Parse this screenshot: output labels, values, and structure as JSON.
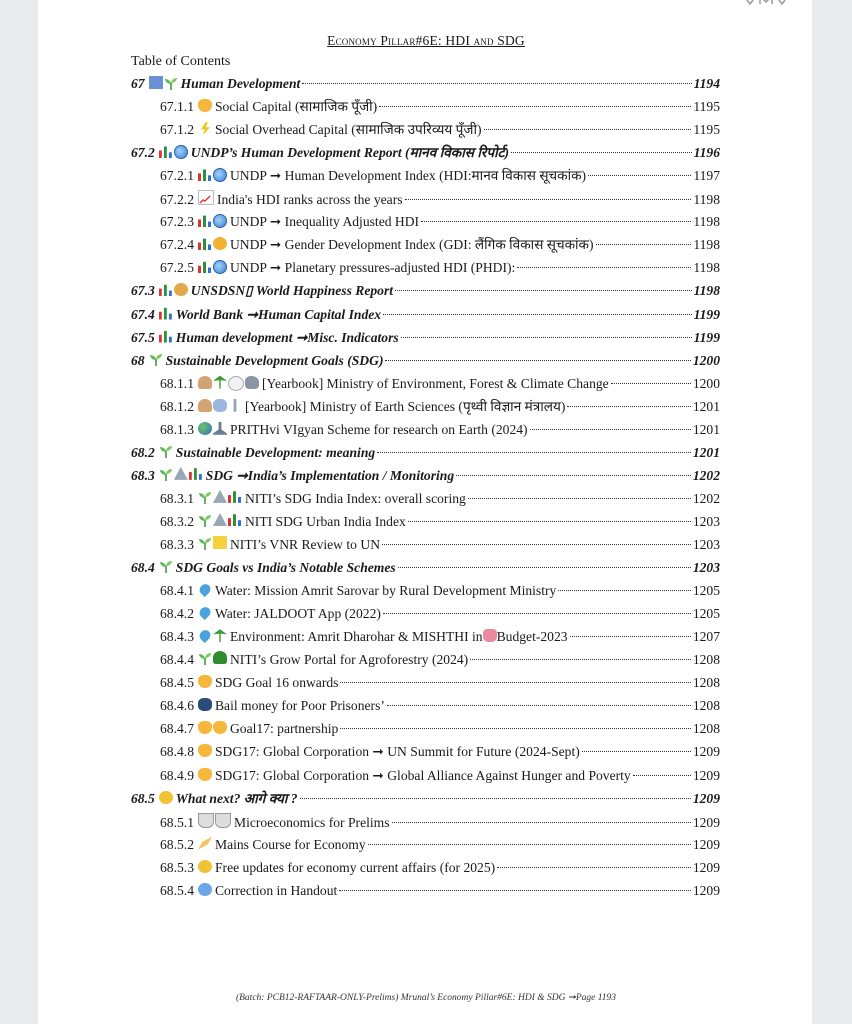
{
  "header": {
    "title": "Economy Pillar#6E: HDI and SDG"
  },
  "toc_title": "Table of Contents",
  "footer": "(Batch: PCB12-RAFTAAR-ONLY-Prelims) Mrunal’s Economy Pillar#6E: HDI & SDG  ➞Page 1193",
  "entries": [
    {
      "level": 1,
      "num": "67",
      "icons": [
        "book-icon",
        "sprout-icon"
      ],
      "title": "Human Development",
      "page": "1194"
    },
    {
      "level": 2,
      "num": "67.1.1",
      "icons": [
        "handshake-icon"
      ],
      "title": "Social Capital (सामाजिक पूँजी)",
      "page": "1195"
    },
    {
      "level": 2,
      "num": "67.1.2",
      "icons": [
        "bolt-icon"
      ],
      "title": "Social Overhead Capital (सामाजिक उपरिव्यय पूँजी)",
      "page": "1195"
    },
    {
      "level": 1,
      "num": "67.2",
      "icons": [
        "chart-icon",
        "globe-icon"
      ],
      "title": "UNDP’s Human Development Report (मानव विकास रिपोर्ट)",
      "page": "1196"
    },
    {
      "level": 2,
      "num": "67.2.1",
      "icons": [
        "chart-icon",
        "globe-icon"
      ],
      "title": "UNDP ➞ Human Development Index (HDI:मानव विकास सूचकांक)",
      "page": "1197"
    },
    {
      "level": 2,
      "num": "67.2.2",
      "icons": [
        "trend-icon"
      ],
      "title": "India's HDI ranks across the years",
      "page": "1198"
    },
    {
      "level": 2,
      "num": "67.2.3",
      "icons": [
        "chart-icon",
        "globe-icon"
      ],
      "title": "UNDP ➞ Inequality Adjusted HDI",
      "page": "1198"
    },
    {
      "level": 2,
      "num": "67.2.4",
      "icons": [
        "chart-icon",
        "face-icon"
      ],
      "title": "UNDP ➞ Gender Development Index (GDI: लैंगिक विकास सूचकांक)",
      "page": "1198"
    },
    {
      "level": 2,
      "num": "67.2.5",
      "icons": [
        "chart-icon",
        "globe-icon"
      ],
      "title": "UNDP ➞ Planetary pressures-adjusted HDI (PHDI):",
      "page": "1198"
    },
    {
      "level": 1,
      "num": "67.3",
      "icons": [
        "chart-icon",
        "cat-icon"
      ],
      "title": "UNSDSN▯   World Happiness Report",
      "page": "1198"
    },
    {
      "level": 1,
      "num": "67.4",
      "icons": [
        "chart-icon"
      ],
      "title": "World Bank ➞Human Capital Index",
      "page": "1199"
    },
    {
      "level": 1,
      "num": "67.5",
      "icons": [
        "chart-icon"
      ],
      "title": "Human development  ➞Misc. Indicators",
      "page": "1199"
    },
    {
      "level": 1,
      "num": "68",
      "icons": [
        "sprout-icon"
      ],
      "title": "Sustainable Development Goals (SDG)",
      "page": "1200"
    },
    {
      "level": 2,
      "num": "68.1.1",
      "icons": [
        "person-icon",
        "palm-icon",
        "swan-icon",
        "elephant-icon"
      ],
      "title": "[Yearbook] Ministry of Environment, Forest & Climate Change",
      "page": "1200"
    },
    {
      "level": 2,
      "num": "68.1.2",
      "icons": [
        "person-icon",
        "rain-icon",
        "tool-icon"
      ],
      "title": " [Yearbook] Ministry of Earth Sciences (पृथ्वी विज्ञान मंत्रालय)",
      "page": "1201"
    },
    {
      "level": 2,
      "num": "68.1.3",
      "icons": [
        "earth-icon",
        "microscope-icon"
      ],
      "title": "PRITHvi VIgyan Scheme for research on Earth (2024)",
      "page": "1201"
    },
    {
      "level": 1,
      "num": "68.2",
      "icons": [
        "sprout-icon"
      ],
      "title": "Sustainable Development: meaning",
      "page": "1201"
    },
    {
      "level": 1,
      "num": "68.3",
      "icons": [
        "sprout-icon",
        "triangle-icon",
        "chart-icon"
      ],
      "title": "SDG  ➞India’s Implementation / Monitoring",
      "page": "1202"
    },
    {
      "level": 2,
      "num": "68.3.1",
      "icons": [
        "sprout-icon",
        "triangle-icon",
        "chart-icon"
      ],
      "title": "NITI’s SDG India Index: overall scoring",
      "page": "1202"
    },
    {
      "level": 2,
      "num": "68.3.2",
      "icons": [
        "sprout-icon",
        "triangle-icon",
        "chart-icon"
      ],
      "title": "NITI SDG Urban India Index",
      "page": "1203"
    },
    {
      "level": 2,
      "num": "68.3.3",
      "icons": [
        "sprout-icon",
        "note-icon"
      ],
      "title": "NITI’s VNR Review to UN",
      "page": "1203"
    },
    {
      "level": 1,
      "num": "68.4",
      "icons": [
        "sprout-icon"
      ],
      "title": "SDG Goals vs India’s Notable Schemes",
      "page": "1203"
    },
    {
      "level": 2,
      "num": "68.4.1",
      "icons": [
        "droplet-icon"
      ],
      "title": "Water: Mission Amrit Sarovar by Rural Development Ministry",
      "page": "1205"
    },
    {
      "level": 2,
      "num": "68.4.2",
      "icons": [
        "droplet-icon"
      ],
      "title": "Water: JALDOOT App (2022)",
      "page": "1205"
    },
    {
      "level": 2,
      "num": "68.4.3",
      "icons": [
        "droplet-icon",
        "palm-icon"
      ],
      "title": "Environment: Amrit Dharohar & MISHTHI in ",
      "page": "1207",
      "title_suffix_icon": "budget-bag-icon",
      "title_suffix": "Budget-2023"
    },
    {
      "level": 2,
      "num": "68.4.4",
      "icons": [
        "sprout-icon",
        "tree-icon"
      ],
      "title": "NITI’s Grow Portal for Agroforestry (2024)",
      "page": "1208"
    },
    {
      "level": 2,
      "num": "68.4.5",
      "icons": [
        "handshake-icon"
      ],
      "title": "SDG Goal 16 onwards",
      "page": "1208"
    },
    {
      "level": 2,
      "num": "68.4.6",
      "icons": [
        "police-icon"
      ],
      "title": "Bail money for Poor Prisoners’",
      "page": "1208"
    },
    {
      "level": 2,
      "num": "68.4.7",
      "icons": [
        "handshake-icon",
        "handshake-icon"
      ],
      "title": " Goal17: partnership",
      "page": "1208"
    },
    {
      "level": 2,
      "num": "68.4.8",
      "icons": [
        "handshake-icon"
      ],
      "title": "SDG17: Global Corporation ➞ UN Summit for Future (2024-Sept)",
      "page": "1209"
    },
    {
      "level": 2,
      "num": "68.4.9",
      "icons": [
        "handshake-icon"
      ],
      "title": "SDG17: Global Corporation ➞ Global Alliance Against Hunger and Poverty",
      "page": "1209"
    },
    {
      "level": 1,
      "num": "68.5",
      "icons": [
        "sun-icon"
      ],
      "title": "What next? आगे क्या ?",
      "page": "1209"
    },
    {
      "level": 2,
      "num": "68.5.1",
      "icons": [
        "cup-icon",
        "cup-icon"
      ],
      "title": "Microeconomics for Prelims",
      "page": "1209"
    },
    {
      "level": 2,
      "num": "68.5.2",
      "icons": [
        "writing-icon"
      ],
      "title": "Mains Course for Economy",
      "page": "1209"
    },
    {
      "level": 2,
      "num": "68.5.3",
      "icons": [
        "sun-icon"
      ],
      "title": "Free updates for economy current affairs (for 2025)",
      "page": "1209"
    },
    {
      "level": 2,
      "num": "68.5.4",
      "icons": [
        "smile-icon"
      ],
      "title": "Correction in Handout",
      "page": "1209"
    }
  ]
}
